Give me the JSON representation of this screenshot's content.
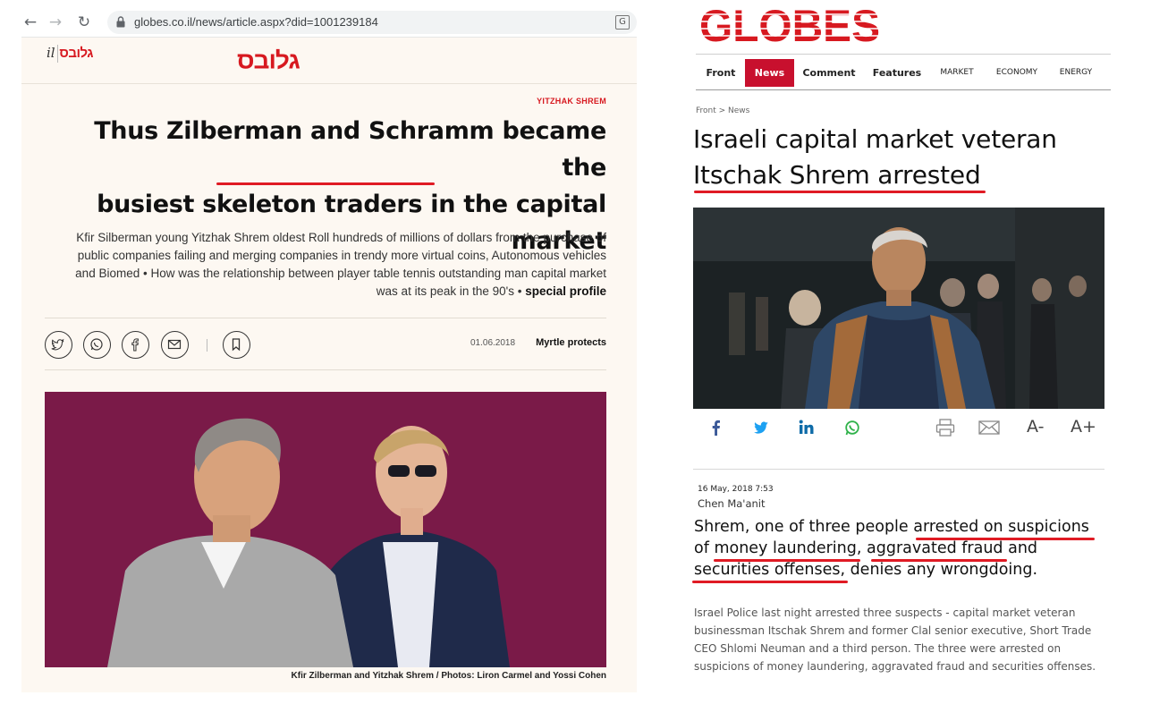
{
  "browser": {
    "url": "globes.co.il/news/article.aspx?did=1001239184",
    "icons": [
      "back-icon",
      "forward-icon",
      "reload-icon",
      "lock-icon",
      "translate-icon"
    ]
  },
  "left_article": {
    "header": {
      "mini_logo_script": "גלובס",
      "mini_logo_prefix": "il",
      "main_logo": "גלובס"
    },
    "author_tag": "YITZHAK SHREM",
    "headline_line1": "Thus Zilberman and Schramm became the",
    "headline_line2_pre": "busiest ",
    "headline_line2_mark": "skeleton traders",
    "headline_line2_post": " in the capital",
    "headline_line3": "market",
    "subtitle": "Kfir Silberman young Yitzhak Shrem oldest Roll hundreds of millions of dollars from the purchase of public companies failing and merging companies in trendy more virtual coins, Autonomous vehicles and Biomed • How was the relationship between player table tennis outstanding man capital market was at its peak in the 90's •",
    "subtitle_bold": "special profile",
    "share_icons": [
      "twitter-icon",
      "whatsapp-icon",
      "facebook-icon",
      "email-icon",
      "bookmark-icon"
    ],
    "date": "01.06.2018",
    "byline": "Myrtle protects",
    "photo_caption": "Kfir Zilberman and Yitzhak Shrem / Photos: Liron Carmel and Yossi Cohen"
  },
  "right_article": {
    "logo": "GLOBES",
    "nav": [
      "Front",
      "News",
      "Comment",
      "Features",
      "MARKET",
      "ECONOMY",
      "ENERGY"
    ],
    "active_nav": "News",
    "breadcrumb": "Front > News",
    "headline_line1": "Israeli capital market veteran",
    "headline_line2": "Itschak Shrem arrested",
    "share_icons": [
      "facebook-icon",
      "twitter-icon",
      "linkedin-icon",
      "whatsapp-icon",
      "print-icon",
      "email-icon"
    ],
    "font_smaller": "A-",
    "font_larger": "A+",
    "date": "16 May, 2018 7:53",
    "author": "Chen Ma'anit",
    "lead_1": "Shrem, one of three people ",
    "lead_mark1": "arrested on suspicions",
    "lead_2": "of ",
    "lead_mark2": "money laundering",
    "lead_3": ", ",
    "lead_mark3": "aggravated fraud",
    "lead_4": " and",
    "lead_mark4": "securities offenses",
    "lead_5": ", denies any wrongdoing.",
    "body": "Israel Police last night arrested three suspects - capital market veteran businessman Itschak Shrem and former Clal senior executive, Short Trade CEO Shlomi Neuman and a third person. The three were arrested on suspicions of money laundering, aggravated fraud and securities offenses."
  },
  "colors": {
    "brand_red": "#d71920",
    "nav_active": "#c8102e",
    "photo_bg": "#7a1a48",
    "annotation": "#e01b24"
  }
}
